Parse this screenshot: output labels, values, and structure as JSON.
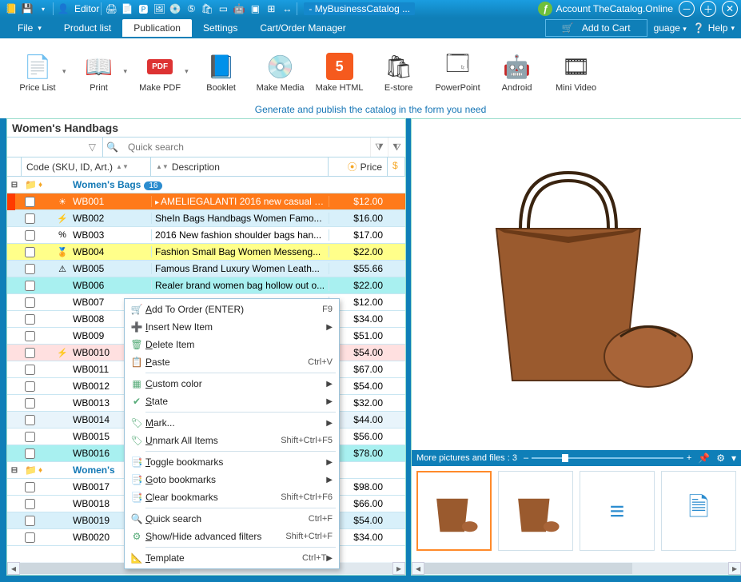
{
  "titlebar": {
    "editor_label": "Editor",
    "app_title": "- MyBusinessCatalog ...",
    "account_label": "Account TheCatalog.Online"
  },
  "menubar": {
    "items": [
      "File",
      "Product list",
      "Publication",
      "Settings",
      "Cart/Order Manager"
    ],
    "active_index": 2,
    "add_to_cart": "Add to Cart",
    "language_tail": "guage",
    "help": "Help"
  },
  "ribbon": {
    "items": [
      {
        "label": "Price List",
        "icon": "📄"
      },
      {
        "label": "Print",
        "icon": "📖"
      },
      {
        "label": "Make PDF",
        "icon": "PDF"
      },
      {
        "label": "Booklet",
        "icon": "📘"
      },
      {
        "label": "Make Media",
        "icon": "💿"
      },
      {
        "label": "Make HTML",
        "icon": "5"
      },
      {
        "label": "E-store",
        "icon": "🛍"
      },
      {
        "label": "PowerPoint",
        "icon": "🗔"
      },
      {
        "label": "Android",
        "icon": "🤖"
      },
      {
        "label": "Mini Video",
        "icon": "🎞"
      }
    ],
    "hint": "Generate and publish the catalog in the form you need"
  },
  "left": {
    "category_title": "Women's Handbags",
    "search_placeholder": "Quick search",
    "columns": {
      "sku": "Code (SKU, ID, Art.)",
      "desc": "Description",
      "price": "Price"
    },
    "group1": {
      "label": "Women's Bags",
      "count": "16"
    },
    "group2": {
      "label": "Women's"
    },
    "rows": [
      {
        "sku": "WB001",
        "desc": "AMELIEGALANTI 2016 new casual w...",
        "price": "$12.00",
        "cls": "sel-orange",
        "badge": "☀"
      },
      {
        "sku": "WB002",
        "desc": "SheIn Bags Handbags Women Famo...",
        "price": "$16.00",
        "cls": "ltblue",
        "badge": "⚡"
      },
      {
        "sku": "WB003",
        "desc": "2016 New fashion shoulder bags han...",
        "price": "$17.00",
        "cls": "",
        "badge": "%"
      },
      {
        "sku": "WB004",
        "desc": "Fashion Small Bag Women Messeng...",
        "price": "$22.00",
        "cls": "yellow",
        "badge": "🏅"
      },
      {
        "sku": "WB005",
        "desc": "Famous Brand Luxury Women Leath...",
        "price": "$55.66",
        "cls": "ltblue",
        "badge": "⚠"
      },
      {
        "sku": "WB006",
        "desc": "Realer brand women bag hollow out o...",
        "price": "$22.00",
        "cls": "cyan",
        "badge": ""
      },
      {
        "sku": "WB007",
        "desc": "",
        "price": "$12.00",
        "cls": "",
        "badge": ""
      },
      {
        "sku": "WB008",
        "desc": "",
        "price": "$34.00",
        "cls": "",
        "badge": ""
      },
      {
        "sku": "WB009",
        "desc": "",
        "price": "$51.00",
        "cls": "",
        "badge": ""
      },
      {
        "sku": "WB0010",
        "desc": "",
        "price": "$54.00",
        "cls": "pink",
        "badge": "⚡"
      },
      {
        "sku": "WB0011",
        "desc": "",
        "price": "$67.00",
        "cls": "",
        "badge": ""
      },
      {
        "sku": "WB0012",
        "desc": "",
        "price": "$54.00",
        "cls": "",
        "badge": ""
      },
      {
        "sku": "WB0013",
        "desc": "",
        "price": "$32.00",
        "cls": "",
        "badge": ""
      },
      {
        "sku": "WB0014",
        "desc": "",
        "price": "$44.00",
        "cls": "ltblue2",
        "badge": ""
      },
      {
        "sku": "WB0015",
        "desc": "",
        "price": "$56.00",
        "cls": "",
        "badge": ""
      },
      {
        "sku": "WB0016",
        "desc": "",
        "price": "$78.00",
        "cls": "cyan",
        "badge": ""
      }
    ],
    "rows2": [
      {
        "sku": "WB0017",
        "desc": "",
        "price": "$98.00",
        "cls": "",
        "badge": ""
      },
      {
        "sku": "WB0018",
        "desc": "",
        "price": "$66.00",
        "cls": "",
        "badge": ""
      },
      {
        "sku": "WB0019",
        "desc": "",
        "price": "$54.00",
        "cls": "ltblue",
        "badge": ""
      },
      {
        "sku": "WB0020",
        "desc": "",
        "price": "$34.00",
        "cls": "",
        "badge": ""
      }
    ]
  },
  "ctx": {
    "items": [
      {
        "icon": "🛒",
        "label": "Add To Order (ENTER)",
        "key": "F9",
        "u": 0
      },
      {
        "icon": "➕",
        "label": "Insert New Item",
        "sub": true,
        "u": 0
      },
      {
        "icon": "🗑",
        "label": "Delete Item",
        "u": 0
      },
      {
        "icon": "📋",
        "label": "Paste",
        "key": "Ctrl+V",
        "u": 0
      },
      {
        "sep": true
      },
      {
        "icon": "▦",
        "label": "Custom color",
        "sub": true,
        "u": 0
      },
      {
        "icon": "✔",
        "label": "State",
        "sub": true,
        "u": 0
      },
      {
        "sep": true
      },
      {
        "icon": "🏷",
        "label": "Mark...",
        "sub": true,
        "u": 0
      },
      {
        "icon": "🏷",
        "label": "Unmark All Items",
        "key": "Shift+Ctrl+F5",
        "u": 0
      },
      {
        "sep": true
      },
      {
        "icon": "📑",
        "label": "Toggle bookmarks",
        "sub": true,
        "u": 0
      },
      {
        "icon": "📑",
        "label": "Goto bookmarks",
        "sub": true,
        "u": 0
      },
      {
        "icon": "📑",
        "label": "Clear bookmarks",
        "key": "Shift+Ctrl+F6",
        "u": 0
      },
      {
        "sep": true
      },
      {
        "icon": "🔍",
        "label": "Quick search",
        "key": "Ctrl+F",
        "u": 0
      },
      {
        "icon": "⚙",
        "label": "Show/Hide advanced filters",
        "key": "Shift+Ctrl+F",
        "u": 0
      },
      {
        "sep": true
      },
      {
        "icon": "📐",
        "label": "Template",
        "key": "Ctrl+T",
        "sub": true,
        "u": 0
      }
    ]
  },
  "right": {
    "thumbs_label": "More pictures and files :  3"
  }
}
